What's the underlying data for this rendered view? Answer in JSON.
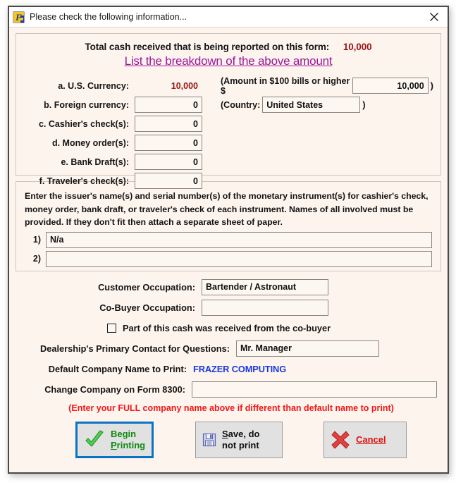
{
  "window": {
    "title": "Please check the following information...",
    "icon": "frazer-f-logo-icon",
    "close_icon": "close-icon"
  },
  "top_panel": {
    "total_label": "Total cash received that is being reported on this form:",
    "total_amount": "10,000",
    "breakdown_link": "List the breakdown of the above amount",
    "rows": [
      {
        "label": "a. U.S. Currency:",
        "value": "10,000",
        "readonly": true
      },
      {
        "label": "b. Foreign currency:",
        "value": "0",
        "readonly": false
      },
      {
        "label": "c. Cashier's check(s):",
        "value": "0",
        "readonly": false
      },
      {
        "label": "d. Money order(s):",
        "value": "0",
        "readonly": false
      },
      {
        "label": "e. Bank Draft(s):",
        "value": "0",
        "readonly": false
      },
      {
        "label": "f. Traveler's check(s):",
        "value": "0",
        "readonly": false
      }
    ],
    "amount_100_label": "(Amount in $100 bills or higher $",
    "amount_100_value": "10,000",
    "amount_100_close": ")",
    "country_label": "(Country:",
    "country_value": "United States",
    "country_close": ")"
  },
  "mid_panel": {
    "instructions": "Enter the issuer's name(s) and serial number(s) of the monetary instrument(s) for cashier's check, money order, bank draft, or traveler's check of each instrument.  Names of all involved must be provided. If they don't fit then attach a separate sheet of paper.",
    "line1_label": "1)",
    "line1_value": "N/a",
    "line2_label": "2)",
    "line2_value": ""
  },
  "lower": {
    "customer_occupation_label": "Customer Occupation:",
    "customer_occupation_value": "Bartender / Astronaut",
    "cobuyer_occupation_label": "Co-Buyer Occupation:",
    "cobuyer_occupation_value": "",
    "cobuyer_checkbox_label": "Part of this cash was received from the co-buyer",
    "cobuyer_checkbox_checked": false,
    "contact_label": "Dealership's Primary Contact for Questions:",
    "contact_value": "Mr. Manager",
    "default_company_label": "Default Company Name to Print:",
    "default_company_value": "FRAZER COMPUTING",
    "change_company_label": "Change Company on Form 8300:",
    "change_company_value": "",
    "red_note": "(Enter your FULL company name above if different than default name to print)"
  },
  "buttons": {
    "begin_printing": {
      "line1": "Begin",
      "line2_pre": "P",
      "line2_rest": "rinting",
      "icon": "green-check-icon"
    },
    "save_no_print": {
      "line1_pre": "S",
      "line1_rest": "ave, do",
      "line2": "not print",
      "icon": "floppy-disk-icon"
    },
    "cancel": {
      "pre": "C",
      "rest": "ancel",
      "icon": "red-x-icon"
    }
  },
  "colors": {
    "accent_blue": "#0A74C4",
    "link_purple": "#9B179B",
    "amount_red": "#9a1414",
    "note_red": "#F21616",
    "company_blue": "#1838E0",
    "panel_bg": "#FDF4EE"
  }
}
